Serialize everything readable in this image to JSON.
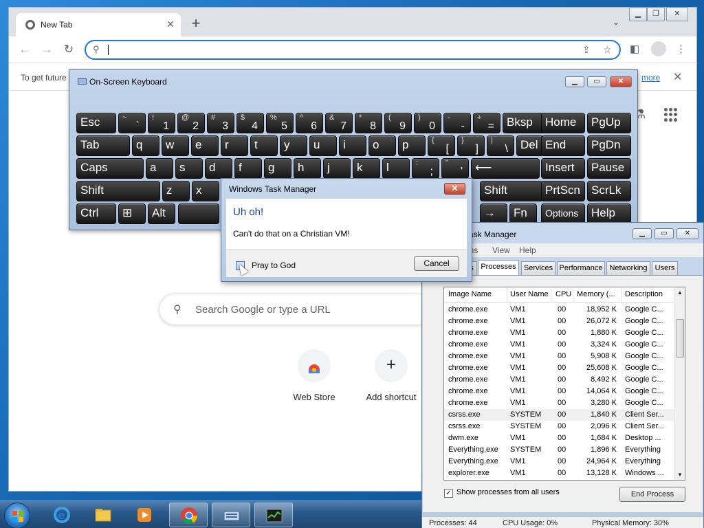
{
  "browser": {
    "tab_title": "New Tab",
    "omnibox_value": "",
    "infobar_text": "To get future",
    "infobar_link": "more",
    "search_placeholder": "Search Google or type a URL",
    "shortcuts": [
      {
        "label": "Web Store"
      },
      {
        "label": "Add shortcut"
      }
    ]
  },
  "osk": {
    "title": "On-Screen Keyboard",
    "rows": [
      [
        {
          "t": "Esc"
        },
        {
          "s": "~",
          "m": "`"
        },
        {
          "s": "!",
          "m": "1"
        },
        {
          "s": "@",
          "m": "2"
        },
        {
          "s": "#",
          "m": "3"
        },
        {
          "s": "$",
          "m": "4"
        },
        {
          "s": "%",
          "m": "5"
        },
        {
          "s": "^",
          "m": "6"
        },
        {
          "s": "&",
          "m": "7"
        },
        {
          "s": "*",
          "m": "8"
        },
        {
          "s": "(",
          "m": "9"
        },
        {
          "s": ")",
          "m": "0"
        },
        {
          "s": "-",
          "m": "-"
        },
        {
          "s": "+",
          "m": "="
        },
        {
          "t": "Bksp"
        },
        {
          "t": "Home"
        },
        {
          "t": "PgUp"
        }
      ],
      [
        {
          "t": "Tab"
        },
        {
          "t": "q"
        },
        {
          "t": "w"
        },
        {
          "t": "e"
        },
        {
          "t": "r"
        },
        {
          "t": "t"
        },
        {
          "t": "y"
        },
        {
          "t": "u"
        },
        {
          "t": "i"
        },
        {
          "t": "o"
        },
        {
          "t": "p"
        },
        {
          "s": "{",
          "m": "["
        },
        {
          "s": "}",
          "m": "]"
        },
        {
          "s": "|",
          "m": "\\"
        },
        {
          "t": "Del"
        },
        {
          "t": "End"
        },
        {
          "t": "PgDn"
        }
      ],
      [
        {
          "t": "Caps"
        },
        {
          "t": "a"
        },
        {
          "t": "s"
        },
        {
          "t": "d"
        },
        {
          "t": "f"
        },
        {
          "t": "g"
        },
        {
          "t": "h"
        },
        {
          "t": "j"
        },
        {
          "t": "k"
        },
        {
          "t": "l"
        },
        {
          "s": ":",
          "m": ";"
        },
        {
          "s": "\"",
          "m": "'"
        },
        {
          "t": "⟵"
        },
        {
          "t": "Insert"
        },
        {
          "t": "Pause"
        }
      ],
      [
        {
          "t": "Shift"
        },
        {
          "t": "z"
        },
        {
          "t": "x"
        },
        {
          "t": "Shift"
        },
        {
          "t": "PrtScn"
        },
        {
          "t": "ScrLk"
        }
      ],
      [
        {
          "t": "Ctrl"
        },
        {
          "t": "⊞"
        },
        {
          "t": "Alt"
        },
        {
          "t": ""
        },
        {
          "t": "→"
        },
        {
          "t": "Fn"
        },
        {
          "t": "Options"
        },
        {
          "t": "Help"
        }
      ]
    ]
  },
  "dialog": {
    "title": "Windows Task Manager",
    "heading": "Uh oh!",
    "message": "Can't do that on a Christian VM!",
    "checkbox_label": "Pray to God",
    "cancel_label": "Cancel"
  },
  "taskmgr": {
    "title": "Task Manager",
    "menu": [
      "ons",
      "View",
      "Help"
    ],
    "tabs": [
      "s",
      "Processes",
      "Services",
      "Performance",
      "Networking",
      "Users"
    ],
    "columns": [
      "Image Name",
      "User Name",
      "CPU",
      "Memory (...",
      "Description"
    ],
    "rows": [
      [
        "chrome.exe",
        "VM1",
        "00",
        "18,952 K",
        "Google C..."
      ],
      [
        "chrome.exe",
        "VM1",
        "00",
        "26,072 K",
        "Google C..."
      ],
      [
        "chrome.exe",
        "VM1",
        "00",
        "1,880 K",
        "Google C..."
      ],
      [
        "chrome.exe",
        "VM1",
        "00",
        "3,324 K",
        "Google C..."
      ],
      [
        "chrome.exe",
        "VM1",
        "00",
        "5,908 K",
        "Google C..."
      ],
      [
        "chrome.exe",
        "VM1",
        "00",
        "25,608 K",
        "Google C..."
      ],
      [
        "chrome.exe",
        "VM1",
        "00",
        "8,492 K",
        "Google C..."
      ],
      [
        "chrome.exe",
        "VM1",
        "00",
        "14,064 K",
        "Google C..."
      ],
      [
        "chrome.exe",
        "VM1",
        "00",
        "3,280 K",
        "Google C..."
      ],
      [
        "csrss.exe",
        "SYSTEM",
        "00",
        "1,840 K",
        "Client Ser..."
      ],
      [
        "csrss.exe",
        "SYSTEM",
        "00",
        "2,096 K",
        "Client Ser..."
      ],
      [
        "dwm.exe",
        "VM1",
        "00",
        "1,684 K",
        "Desktop ..."
      ],
      [
        "Everything.exe",
        "SYSTEM",
        "00",
        "1,896 K",
        "Everything"
      ],
      [
        "Everything.exe",
        "VM1",
        "00",
        "24,964 K",
        "Everything"
      ],
      [
        "explorer.exe",
        "VM1",
        "00",
        "13,128 K",
        "Windows ..."
      ]
    ],
    "selected_row": 9,
    "show_all_label": "Show processes from all users",
    "show_all_checked": true,
    "end_process_label": "End Process",
    "status": {
      "processes": "Processes: 44",
      "cpu": "CPU Usage: 0%",
      "memory": "Physical Memory: 30%"
    }
  },
  "taskbar": {
    "items": [
      {
        "icon": "internet-explorer-icon",
        "open": false
      },
      {
        "icon": "file-explorer-icon",
        "open": false
      },
      {
        "icon": "media-player-icon",
        "open": false
      },
      {
        "icon": "chrome-icon",
        "open": true
      },
      {
        "icon": "on-screen-keyboard-icon",
        "open": true
      },
      {
        "icon": "task-manager-icon",
        "open": true
      }
    ]
  },
  "colors": {
    "accent": "#1a73e8",
    "dialog_heading": "#1e3b8a",
    "close_red": "#c4412b"
  }
}
